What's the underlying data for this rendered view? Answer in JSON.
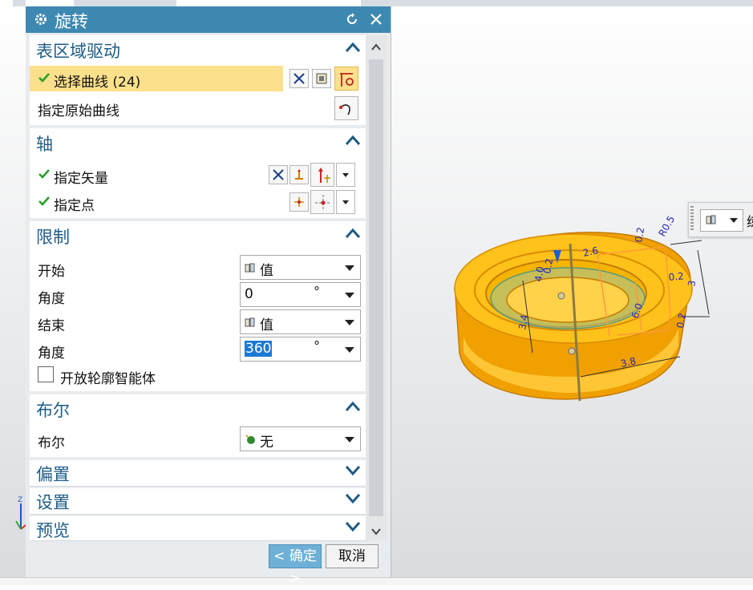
{
  "dialog": {
    "title": "旋转",
    "sections": {
      "region_drive": {
        "title": "表区域驱动",
        "select_curve_label": "选择曲线 (24)",
        "origin_curve_label": "指定原始曲线"
      },
      "axis": {
        "title": "轴",
        "vector_label": "指定矢量",
        "point_label": "指定点"
      },
      "limits": {
        "title": "限制",
        "start_label": "开始",
        "start_value": "值",
        "start_angle_label": "角度",
        "start_angle_value": "0",
        "end_label": "结束",
        "end_value": "值",
        "end_angle_label": "角度",
        "end_angle_value": "360",
        "angle_unit": "°",
        "open_profile_label": "开放轮廓智能体"
      },
      "boolean": {
        "title": "布尔",
        "boolean_label": "布尔",
        "boolean_value": "无"
      },
      "offset": {
        "title": "偏置"
      },
      "settings": {
        "title": "设置"
      },
      "preview": {
        "title": "预览"
      }
    },
    "ok_label": "< 确定 >",
    "cancel_label": "取消"
  },
  "viewport": {
    "float_toolbar_text": "练",
    "dimensions": [
      "R0.5",
      "0.2",
      "2.6",
      "0.2",
      "3",
      "3.8",
      "0.2",
      "3.4",
      "4.0",
      "6.0",
      "0.2"
    ],
    "model_color": "#f5a900"
  },
  "colors": {
    "title_bar": "#3e89b2",
    "section_title": "#1d5c86",
    "highlight": "#fde08b",
    "checkmark": "#2a9d2a"
  }
}
